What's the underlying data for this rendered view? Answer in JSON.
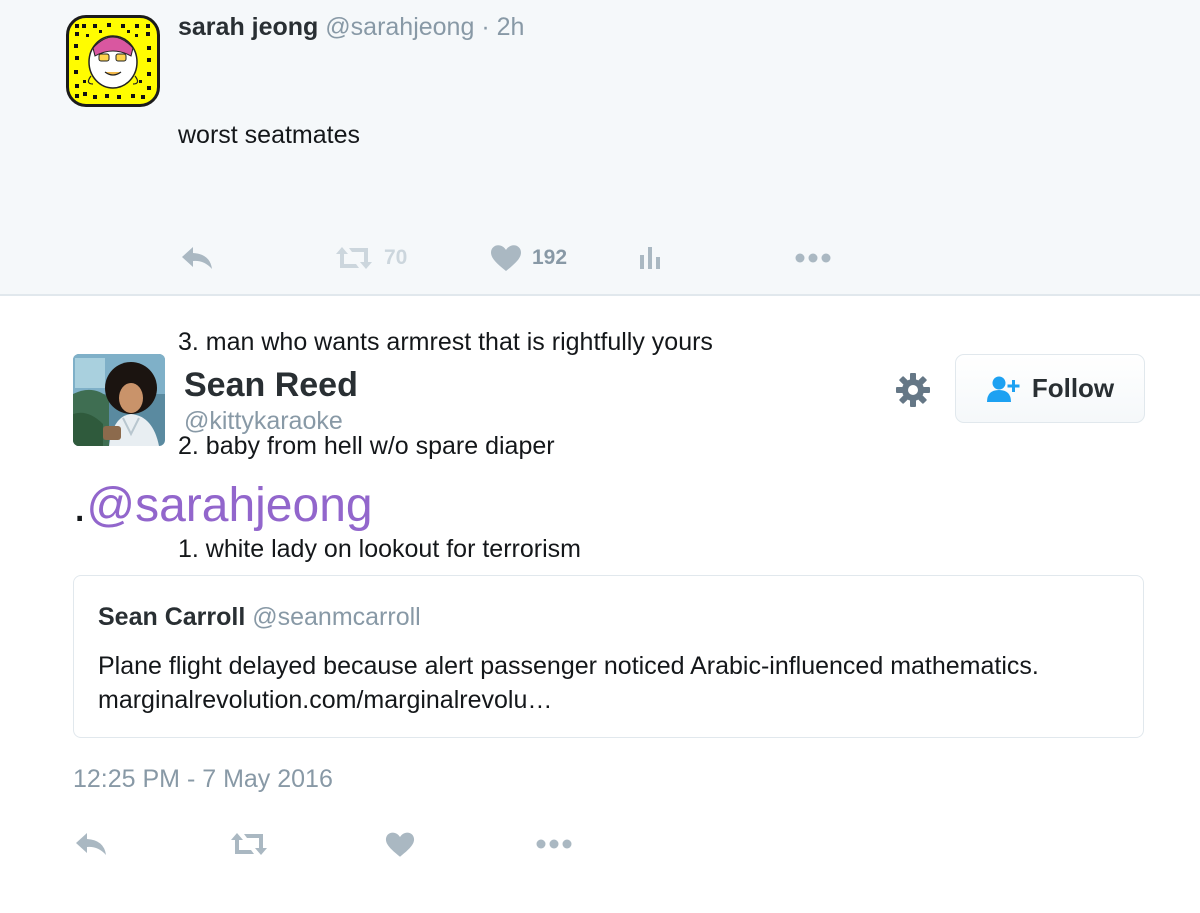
{
  "parent_tweet": {
    "name": "sarah jeong",
    "handle": "@sarahjeong",
    "time": " · 2h",
    "text_lines": [
      "worst seatmates",
      "",
      "3. man who wants armrest that is rightfully yours",
      "2. baby from hell w/o spare diaper",
      "1. white lady on lookout for terrorism"
    ],
    "retweet_count": "70",
    "like_count": "192",
    "icons": [
      "reply-icon",
      "retweet-icon",
      "heart-icon",
      "analytics-icon",
      "more-icon"
    ]
  },
  "main_tweet": {
    "name": "Sean Reed",
    "handle": "@kittykaraoke",
    "follow_label": "Follow",
    "text_prefix": ".",
    "mention": "@sarahjeong",
    "quoted": {
      "name": "Sean Carroll",
      "handle": "@seanmcarroll",
      "text": "Plane flight delayed because alert passenger noticed Arabic-influenced mathematics.",
      "link": "marginalrevolution.com/marginalrevolu…"
    },
    "timestamp": "12:25 PM - 7 May 2016",
    "icons": [
      "reply-icon",
      "retweet-icon",
      "heart-icon",
      "more-icon"
    ]
  },
  "colors": {
    "parent_bg": "#f5f8fa",
    "divider": "#e1e8ed",
    "icon_gray": "#aab8c2",
    "secondary_text": "#8899a6",
    "mention": "#9266cc",
    "follow_icon": "#1da1f2",
    "snapcode_yellow": "#fffc00"
  }
}
